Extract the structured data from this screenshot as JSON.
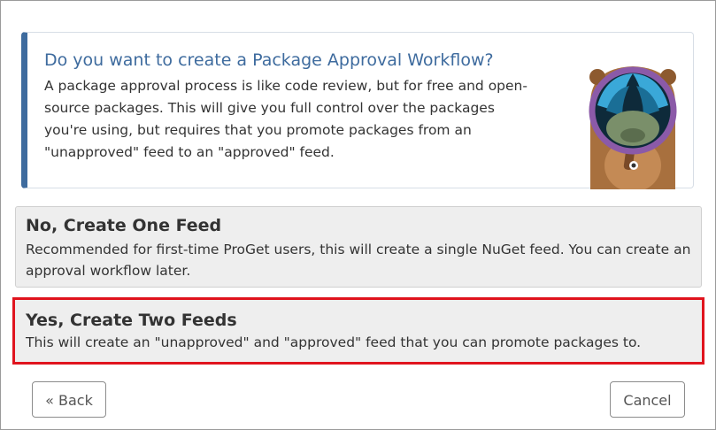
{
  "prompt": {
    "title": "Do you want to create a Package Approval Workflow?",
    "description": "A package approval process is like code review, but for free and open-source packages. This will give you full control over the packages you're using, but requires that you promote packages from an \"unapproved\" feed to an \"approved\" feed.",
    "mascot_icon": "groundhog-magnifying-glass-icon"
  },
  "options": [
    {
      "title": "No, Create One Feed",
      "description": "Recommended for first-time ProGet users, this will create a single NuGet feed. You can create an approval workflow later."
    },
    {
      "title": "Yes, Create Two Feeds",
      "description": "This will create an \"unapproved\" and \"approved\" feed that you can promote packages to.",
      "highlighted": true
    }
  ],
  "buttons": {
    "back": "« Back",
    "cancel": "Cancel"
  },
  "colors": {
    "accent": "#3e6b9e",
    "highlight": "#e0141e",
    "card_background": "#eeeeee"
  }
}
